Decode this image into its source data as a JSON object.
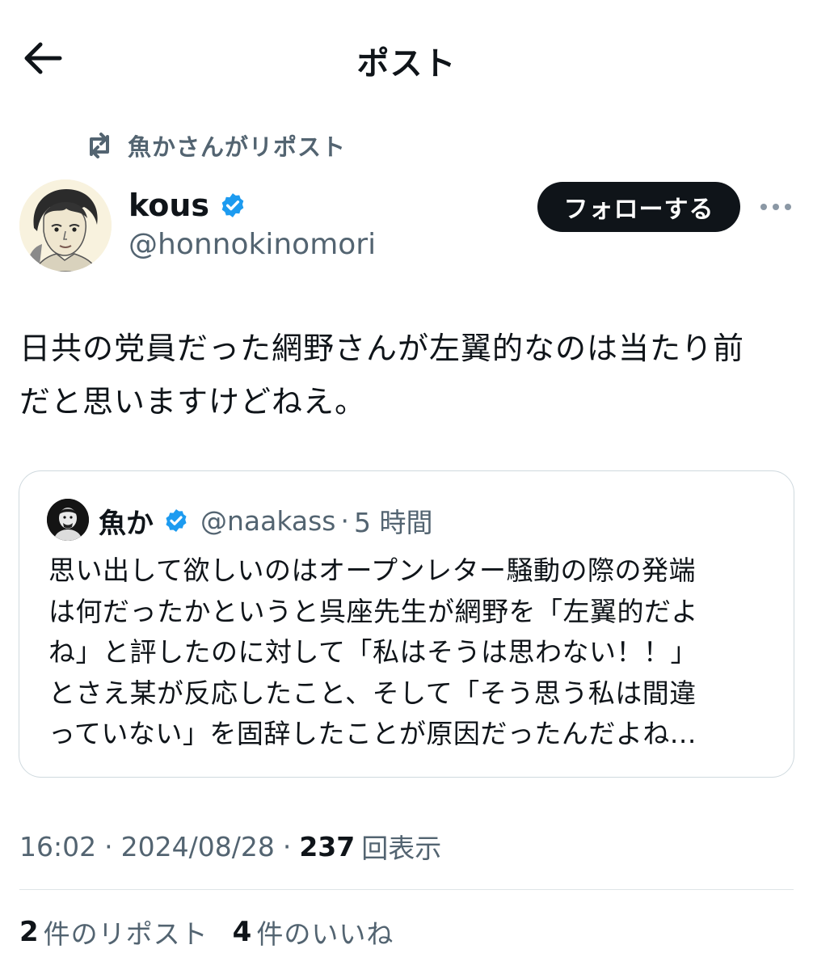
{
  "header": {
    "title": "ポスト"
  },
  "repost_context": {
    "text": "魚かさんがリポスト"
  },
  "author": {
    "name": "kous",
    "handle": "@honnokinomori"
  },
  "follow_button": {
    "label": "フォローする"
  },
  "post": {
    "text_lines": [
      "日共の党員だった網野さんが左翼的なのは当たり前",
      "だと思いますけどねえ。"
    ]
  },
  "quote": {
    "name": "魚か",
    "handle": "@naakass",
    "separator": "·",
    "time": "5 時間",
    "text_lines": [
      "思い出して欲しいのはオープンレター騒動の際の発端",
      "は何だったかというと呉座先生が網野を「左翼的だよ",
      "ね」と評したのに対して「私はそうは思わない！！」",
      "とさえ某が反応したこと、そして「そう思う私は間違",
      "っていない」を固辞したことが原因だったんだよね..."
    ]
  },
  "meta": {
    "time": "16:02",
    "separator": "·",
    "date": "2024/08/28",
    "views_count": "237",
    "views_label": "回表示"
  },
  "stats": {
    "reposts_count": "2",
    "reposts_label": "件のリポスト",
    "likes_count": "4",
    "likes_label": "件のいいね"
  },
  "icons": {
    "back": "arrow-left-icon",
    "repost": "repost-icon",
    "verified": "verified-badge-icon",
    "more": "more-dots-icon"
  },
  "colors": {
    "text_primary": "#0f1419",
    "text_secondary": "#536471",
    "verified_blue": "#1d9bf0",
    "follow_bg": "#0f1419",
    "border": "#cfd9de"
  }
}
